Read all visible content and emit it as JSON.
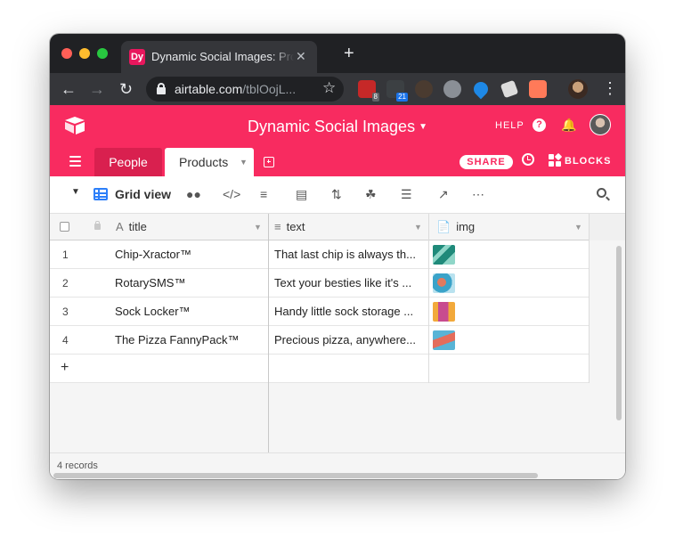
{
  "browser": {
    "tab_favicon": "Dy",
    "tab_title": "Dynamic Social Images: Products",
    "tab_close": "✕",
    "new_tab": "+",
    "url_host": "airtable.com",
    "url_path": "/tblOojL...",
    "extensions": [
      {
        "name": "ublock-origin-icon",
        "badge": "8",
        "color": "#c62828"
      },
      {
        "name": "extension-icon",
        "badge": "21",
        "color": "#3c4043"
      },
      {
        "name": "cat-extension-icon",
        "badge": "",
        "color": "#4a3b30"
      },
      {
        "name": "feather-extension-icon",
        "badge": "",
        "color": "#8a8f96"
      },
      {
        "name": "shield-extension-icon",
        "badge": "",
        "color": "#1e88e5"
      },
      {
        "name": "tag-extension-icon",
        "badge": "",
        "color": "#dcdcdc"
      },
      {
        "name": "hubspot-icon",
        "badge": "",
        "color": "#ff7a59"
      }
    ]
  },
  "header": {
    "base_title": "Dynamic Social Images",
    "help_label": "HELP",
    "help_glyph": "?",
    "share_label": "SHARE",
    "blocks_label": "BLOCKS"
  },
  "tables": {
    "people": "People",
    "products": "Products"
  },
  "viewbar": {
    "view_name": "Grid view"
  },
  "grid": {
    "columns": [
      {
        "label": "title",
        "icon": "text-icon"
      },
      {
        "label": "text",
        "icon": "long-text-icon"
      },
      {
        "label": "img",
        "icon": "attachment-icon"
      }
    ],
    "rows": [
      {
        "num": "1",
        "title": "Chip-Xractor™",
        "text": "That last chip is always th...",
        "thumb_colors": [
          "#1f8a7a",
          "#8fd6c8"
        ]
      },
      {
        "num": "2",
        "title": "RotarySMS™",
        "text": "Text your besties like it's ...",
        "thumb_colors": [
          "#3aa3c9",
          "#e07a5f"
        ]
      },
      {
        "num": "3",
        "title": "Sock Locker™",
        "text": "Handy little sock storage ...",
        "thumb_colors": [
          "#f2a93b",
          "#c84b8f"
        ]
      },
      {
        "num": "4",
        "title": "The Pizza FannyPack™",
        "text": "Precious pizza, anywhere...",
        "thumb_colors": [
          "#58b4d6",
          "#e46d5b"
        ]
      }
    ],
    "add_row": "+",
    "record_count": "4 records"
  },
  "colors": {
    "brand": "#f82b60",
    "accent": "#2d7ff9"
  }
}
